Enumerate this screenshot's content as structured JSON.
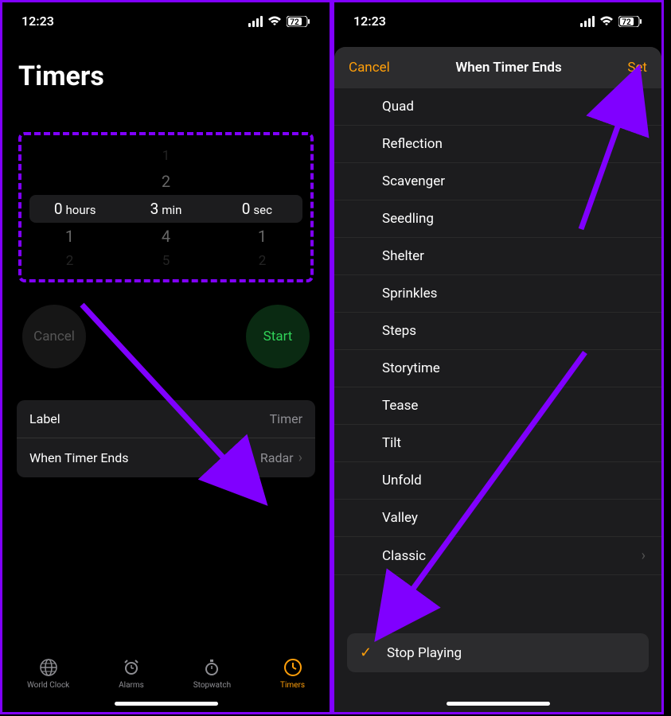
{
  "statusbar": {
    "time": "12:23",
    "battery": "72"
  },
  "left": {
    "title": "Timers",
    "picker": {
      "hours": "0",
      "hours_lbl": "hours",
      "min": "3",
      "min_lbl": "min",
      "sec": "0",
      "sec_lbl": "sec",
      "above1_h": "",
      "above1_m": "1",
      "above1_s": "",
      "above2_h": "",
      "above2_m": "2",
      "above2_s": "",
      "below1_h": "1",
      "below1_m": "4",
      "below1_s": "1",
      "below2_h": "2",
      "below2_m": "5",
      "below2_s": "2"
    },
    "cancel": "Cancel",
    "start": "Start",
    "opt_label": "Label",
    "opt_label_val": "Timer",
    "opt_ends": "When Timer Ends",
    "opt_ends_val": "Radar",
    "tabs": {
      "world": "World Clock",
      "alarms": "Alarms",
      "stopwatch": "Stopwatch",
      "timers": "Timers"
    }
  },
  "right": {
    "cancel": "Cancel",
    "title": "When Timer Ends",
    "set": "Set",
    "items": [
      "Quad",
      "Reflection",
      "Scavenger",
      "Seedling",
      "Shelter",
      "Sprinkles",
      "Steps",
      "Storytime",
      "Tease",
      "Tilt",
      "Unfold",
      "Valley",
      "Classic"
    ],
    "stop": "Stop Playing"
  }
}
